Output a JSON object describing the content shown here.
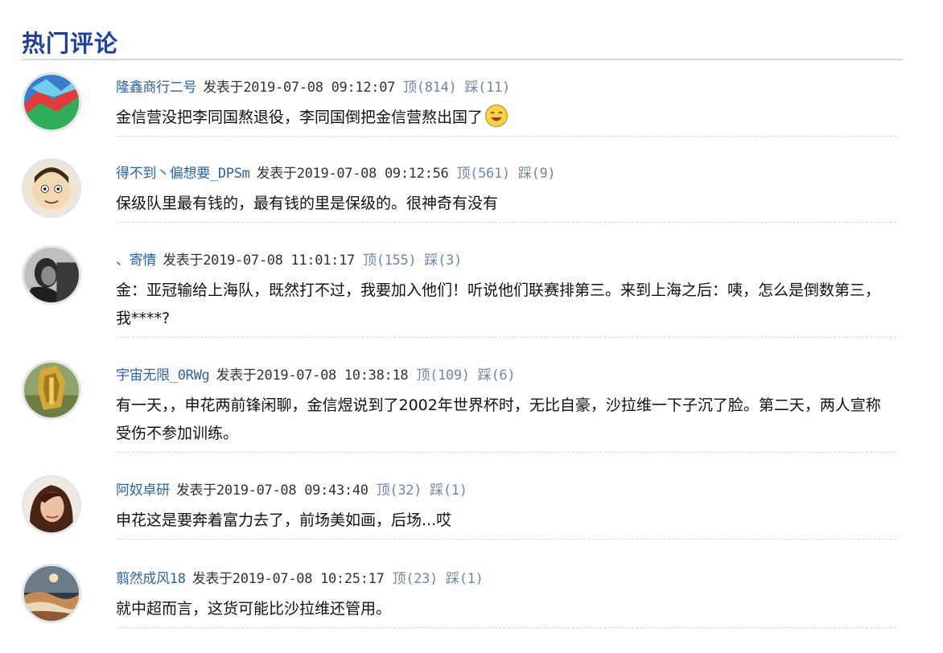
{
  "section": {
    "title": "热门评论"
  },
  "labels": {
    "posted_at": "发表于",
    "up": "顶",
    "down": "踩"
  },
  "comments": [
    {
      "username": "隆鑫商行二号",
      "timestamp": "2019-07-08 09:12:07",
      "up": "(814)",
      "down": "(11)",
      "text": "金信营没把李同国熬退役，李同国倒把金信营熬出国了",
      "emoji": "laughing-face-icon"
    },
    {
      "username": "得不到丶偏想要_DPSm",
      "timestamp": "2019-07-08 09:12:56",
      "up": "(561)",
      "down": "(9)",
      "text": "保级队里最有钱的，最有钱的里是保级的。很神奇有没有"
    },
    {
      "username": "、寄情",
      "timestamp": "2019-07-08 11:01:17",
      "up": "(155)",
      "down": "(3)",
      "text": "金：亚冠输给上海队，既然打不过，我要加入他们！听说他们联赛排第三。来到上海之后：咦，怎么是倒数第三，我****?"
    },
    {
      "username": "宇宙无限_0RWg",
      "timestamp": "2019-07-08 10:38:18",
      "up": "(109)",
      "down": "(6)",
      "text": "有一天，，申花两前锋闲聊，金信煜说到了2002年世界杯时，无比自豪，沙拉维一下子沉了脸。第二天，两人宣称受伤不参加训练。"
    },
    {
      "username": "阿奴卓研",
      "timestamp": "2019-07-08 09:43:40",
      "up": "(32)",
      "down": "(1)",
      "text": "申花这是要奔着富力去了，前场美如画，后场...哎"
    },
    {
      "username": "翦然成风18",
      "timestamp": "2019-07-08 10:25:17",
      "up": "(23)",
      "down": "(1)",
      "text": "就中超而言，这货可能比沙拉维还管用。"
    }
  ]
}
